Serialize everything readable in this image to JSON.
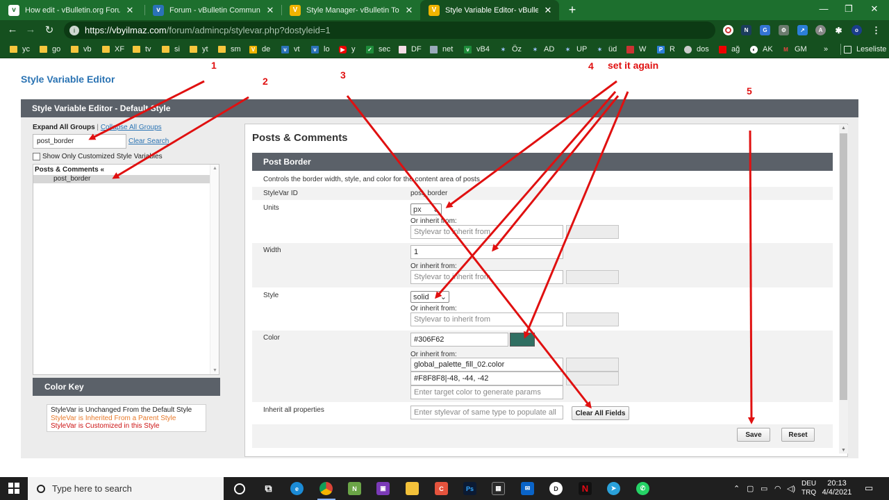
{
  "browser": {
    "tabs": [
      {
        "title": "How edit - vBulletin.org Forum",
        "active": false
      },
      {
        "title": "Forum - vBulletin Community Fo",
        "active": false
      },
      {
        "title": "Style Manager- vBulletin Toplulu",
        "active": false
      },
      {
        "title": "Style Variable Editor- vBulletin To",
        "active": true
      }
    ],
    "url_host": "https://vbyilmaz.com",
    "url_path": "/forum/admincp/stylevar.php?dostyleid=1",
    "bookmarks": [
      "yc",
      "go",
      "vb",
      "XF",
      "tv",
      "si",
      "yt",
      "sm",
      "de",
      "vt",
      "lo",
      "y",
      "sec",
      "DF",
      "net",
      "vB4",
      "Öz",
      "AD",
      "UP",
      "üd",
      "W",
      "R",
      "dos",
      "ağ",
      "AK",
      "GM"
    ],
    "bookmarks_overflow": "»",
    "reading_list": "Leseliste",
    "accent_color": "#1d6f2e"
  },
  "page": {
    "title": "Style Variable Editor",
    "editor_header": "Style Variable Editor - Default Style",
    "left": {
      "expand_all": "Expand All Groups",
      "separator": "|",
      "collapse_all": "Collapse All Groups",
      "search_value": "post_border",
      "clear_search": "Clear Search",
      "show_only_label": "Show Only Customized Style Variables",
      "group_title": "Posts & Comments «",
      "group_item": "post_border",
      "color_key_title": "Color Key",
      "color_key": [
        {
          "text": "StyleVar is Unchanged From the Default Style",
          "color": "#222222"
        },
        {
          "text": "StyleVar is Inherited From a Parent Style",
          "color": "#e8792a"
        },
        {
          "text": "StyleVar is Customized in this Style",
          "color": "#cc1111"
        }
      ]
    },
    "right": {
      "section_title": "Posts & Comments",
      "subsection_title": "Post Border",
      "description": "Controls the border width, style, and color for the content area of posts",
      "stylevar_id_label": "StyleVar ID",
      "stylevar_id_value": "post_border",
      "units_label": "Units",
      "units_value": "px",
      "width_label": "Width",
      "width_value": "1",
      "style_label": "Style",
      "style_value": "solid",
      "color_label": "Color",
      "color_value": "#306F62",
      "color_swatch": "#306F62",
      "or_inherit": "Or inherit from:",
      "inherit_placeholder": "Stylevar to inherit from",
      "color_inherit_value": "global_palette_fill_02.color",
      "color_params_value": "#F8F8F8|-48, -44, -42",
      "color_target_placeholder": "Enter target color to generate params",
      "inherit_all_label": "Inherit all properties",
      "inherit_all_placeholder": "Enter stylevar of same type to populate all",
      "clear_all_button": "Clear All Fields",
      "save_button": "Save",
      "reset_button": "Reset"
    }
  },
  "annotations": {
    "numbers": [
      "1",
      "2",
      "3",
      "4",
      "5"
    ],
    "note": "set it again",
    "color": "#e01010"
  },
  "taskbar": {
    "search_placeholder": "Type here to search",
    "lang_top": "DEU",
    "lang_bottom": "TRQ",
    "time": "20:13",
    "date": "4/4/2021"
  }
}
